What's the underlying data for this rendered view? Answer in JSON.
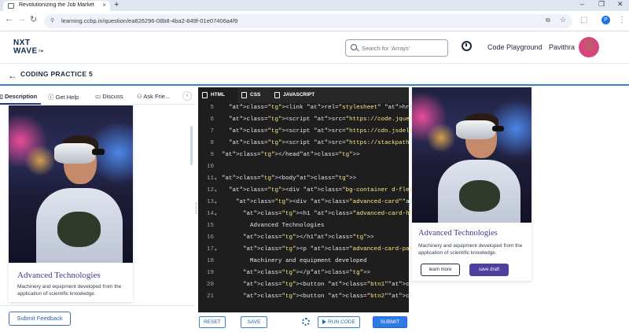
{
  "browser": {
    "tab_title": "Revolutionizing the Job Market",
    "tab_close": "×",
    "new_tab": "+",
    "url": "learning.ccbp.in/question/ea826296-08b8-4ba2-849f-01e07406a4f9",
    "profile_initial": "P"
  },
  "header": {
    "logo_line1": "NXT",
    "logo_line2": "WAVE",
    "logo_tm": "TM",
    "search_placeholder": "Search for 'Arrays'",
    "code_playground": "Code Playground",
    "user_name": "Pavithra"
  },
  "problem": {
    "title": "CODING PRACTICE 5"
  },
  "left_tabs": [
    {
      "label": "Description"
    },
    {
      "label": "Get Help"
    },
    {
      "label": "Discuss"
    },
    {
      "label": "Ask Frie..."
    }
  ],
  "card": {
    "heading": "Advanced Technologies",
    "para": "Machinery and equipment developed from the application of scientific knowledge.",
    "btn1": "learn more",
    "btn2": "save draft"
  },
  "left_footer": {
    "submit_feedback": "Submit Feedback"
  },
  "editor": {
    "tabs": [
      {
        "label": "HTML"
      },
      {
        "label": "CSS"
      },
      {
        "label": "JAVASCRIPT"
      }
    ],
    "line_numbers": [
      "5",
      "6",
      "7",
      "8",
      "9",
      "10",
      "11",
      "12",
      "13",
      "14",
      "15",
      "16",
      "17",
      "18",
      "19",
      "20",
      "21"
    ],
    "lines": [
      "<link rel=\"stylesheet\" href=\"https://stackpath",
      "<script src=\"https://code.jquery.com/jquery-3.",
      "<script src=\"https://cdn.jsdelivr.net/npm/popp",
      "<script src=\"https://stackpath.bootstrapcdn.co",
      "</head>",
      "",
      "<body>",
      "<div class=\"bg-container d-flex flex-column ju",
      "<div class=\"advanced-card\">",
      "<h1 class=\"advanced-card-heading\">",
      "Advanced Technologies",
      "</h1>",
      "<p class=\"advanced-card-para\">",
      "Machinery and equipment developed",
      "</p>",
      "<button class=\"btn1\">learn more</butto",
      "<button class=\"btn2\">save draft</butto"
    ]
  },
  "editor_footer": {
    "reset": "RESET",
    "save": "SAVE",
    "run_code": "RUN CODE",
    "submit": "SUBMIT"
  },
  "colors": {
    "accent": "#2e7be8",
    "brand_purple": "#4c3fa0",
    "heading_purple": "#3d3a8c",
    "editor_bg": "#1e1e1e"
  }
}
